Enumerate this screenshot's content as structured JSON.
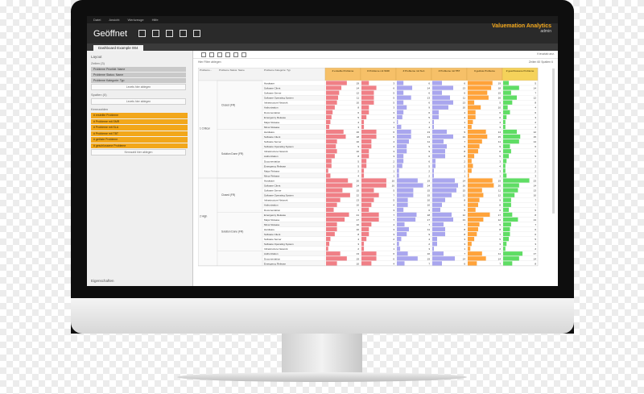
{
  "app": {
    "menus": [
      "Datei",
      "Ansicht",
      "Werkzeuge",
      "Hilfe"
    ],
    "title": "Geöffnet",
    "brand": "Valuemation Analytics",
    "user": "admin",
    "tab": "Dashboard Example 004"
  },
  "left_panel": {
    "layout_label": "Layout",
    "rows_label": "Zeilen (3)",
    "row_fields": [
      "Probleme Priorität: Name",
      "Probleme Status: Name",
      "Probleme Kategorie: Typ"
    ],
    "rows_drop": "Levels hier ablegen",
    "cols_label": "Spalten (0)",
    "cols_drop": "Levels hier ablegen",
    "measures_label": "Kennzahlen",
    "measures": [
      "# erstellte Probleme",
      "# Probleme mit SMR",
      "# Probleme mit SLA",
      "# Probleme mit TBT",
      "# gelöste Probleme",
      "# geschlossene Probleme"
    ],
    "measures_drop": "Kennzahl hier ablegen",
    "properties_label": "Eigenschaften"
  },
  "right_panel": {
    "filter_label": "Hier Filter ablegen",
    "toolbar_label": "Kreuztab anz.",
    "rows_cols": "Zeilen 60 Spalten 6",
    "header_cols": [
      "Probleme...",
      "Probleme Status: Name",
      "Probleme Kategorie: Typ"
    ],
    "measure_headers": [
      "# erstellte Probleme",
      "# Probleme mit SMR",
      "# Probleme mit SLA",
      "# Probleme mit TBT",
      "# gelöste Probleme",
      "# geschlossene Probleme"
    ],
    "priorities": [
      "1 Critical",
      "2 High"
    ],
    "statuses": [
      "Closed (FR)",
      "Solution Done (FR)",
      "Closed (FR)",
      "Solution Done (FR)",
      ""
    ],
    "categories": [
      "Hardware",
      "Software Client",
      "Software Server",
      "Software Operating System",
      "Infrastructure Network",
      "Authorization",
      "Documentation",
      "Emergency Release",
      "Major Release",
      "Minor Release"
    ],
    "values": [
      [
        19,
        3,
        6,
        6,
        19,
        5
      ],
      [
        14,
        6,
        14,
        13,
        18,
        14
      ],
      [
        12,
        5,
        6,
        6,
        15,
        7
      ],
      [
        11,
        5,
        13,
        11,
        16,
        12
      ],
      [
        10,
        5,
        6,
        13,
        5,
        8
      ],
      [
        8,
        3,
        9,
        10,
        10,
        4
      ],
      [
        6,
        3,
        6,
        4,
        6,
        6
      ],
      [
        5,
        2,
        5,
        4,
        6,
        3
      ],
      [
        4,
        1,
        1,
        1,
        4,
        2
      ],
      [
        3,
        1,
        4,
        1,
        3,
        2
      ],
      [
        16,
        6,
        13,
        9,
        14,
        12
      ],
      [
        18,
        6,
        13,
        13,
        15,
        15
      ],
      [
        10,
        4,
        11,
        7,
        11,
        14
      ],
      [
        9,
        4,
        9,
        9,
        9,
        6
      ],
      [
        10,
        3,
        9,
        8,
        8,
        7
      ],
      [
        8,
        3,
        6,
        8,
        5,
        5
      ],
      [
        5,
        2,
        6,
        2,
        3,
        3
      ],
      [
        5,
        2,
        5,
        2,
        4,
        2
      ],
      [
        2,
        1,
        2,
        1,
        3,
        2
      ],
      [
        4,
        1,
        2,
        1,
        1,
        3
      ],
      [
        20,
        10,
        19,
        14,
        19,
        23
      ],
      [
        24,
        10,
        24,
        16,
        20,
        14
      ],
      [
        15,
        5,
        15,
        15,
        11,
        13
      ],
      [
        22,
        7,
        15,
        12,
        12,
        10
      ],
      [
        13,
        5,
        10,
        8,
        9,
        7
      ],
      [
        10,
        4,
        10,
        6,
        8,
        7
      ],
      [
        7,
        3,
        6,
        5,
        6,
        5
      ],
      [
        21,
        7,
        18,
        12,
        17,
        8
      ],
      [
        17,
        7,
        17,
        13,
        12,
        13
      ],
      [
        10,
        4,
        7,
        7,
        9,
        7
      ],
      [
        10,
        3,
        11,
        8,
        8,
        6
      ],
      [
        8,
        3,
        9,
        8,
        7,
        6
      ],
      [
        4,
        2,
        4,
        3,
        5,
        5
      ],
      [
        3,
        1,
        2,
        3,
        3,
        3
      ],
      [
        2,
        1,
        3,
        1,
        2,
        2
      ],
      [
        13,
        6,
        10,
        7,
        11,
        17
      ],
      [
        19,
        6,
        19,
        14,
        14,
        14
      ],
      [
        10,
        4,
        7,
        6,
        7,
        8
      ]
    ],
    "colors": [
      "#f07f86",
      "#f07f86",
      "#a9a6ee",
      "#a9a6ee",
      "#ffa33a",
      "#5fdd64"
    ]
  }
}
